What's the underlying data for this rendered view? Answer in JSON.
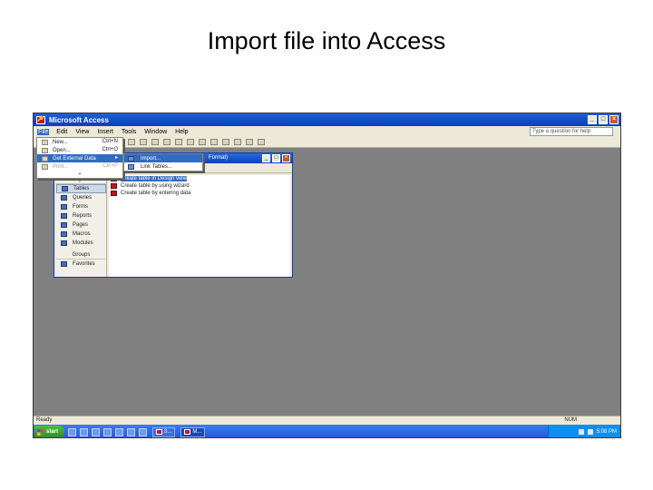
{
  "slide": {
    "title": "Import file into Access"
  },
  "window": {
    "title": "Microsoft Access",
    "min": "_",
    "max": "□",
    "close": "×"
  },
  "menubar": {
    "items": [
      "File",
      "Edit",
      "View",
      "Insert",
      "Tools",
      "Window",
      "Help"
    ],
    "help_placeholder": "Type a question for help"
  },
  "file_menu": {
    "items": [
      {
        "label": "New...",
        "shortcut": "Ctrl+N",
        "state": "normal"
      },
      {
        "label": "Open...",
        "shortcut": "Ctrl+O",
        "state": "normal"
      },
      {
        "label": "Get External Data",
        "state": "highlighted",
        "has_submenu": true
      },
      {
        "label": "Print...",
        "shortcut": "Ctrl+P",
        "state": "disabled"
      }
    ],
    "more": "⌄"
  },
  "submenu": {
    "items": [
      {
        "label": "Import...",
        "state": "highlighted"
      },
      {
        "label": "Link Tables...",
        "state": "normal"
      }
    ]
  },
  "db_window": {
    "title": "Format)",
    "objects_header": "Objects",
    "objects": [
      "Tables",
      "Queries",
      "Forms",
      "Reports",
      "Pages",
      "Macros",
      "Modules"
    ],
    "selected_object": "Tables",
    "groups_header": "Groups",
    "groups": [
      "Favorites"
    ],
    "list": [
      {
        "label": "Create table in Design view",
        "selected": true
      },
      {
        "label": "Create table by using wizard",
        "selected": false
      },
      {
        "label": "Create table by entering data",
        "selected": false
      }
    ]
  },
  "status": {
    "text": "Ready",
    "num": "NUM"
  },
  "taskbar": {
    "start": "start",
    "tasks": [
      "3...",
      "M..."
    ],
    "clock": "5:08 PM"
  }
}
